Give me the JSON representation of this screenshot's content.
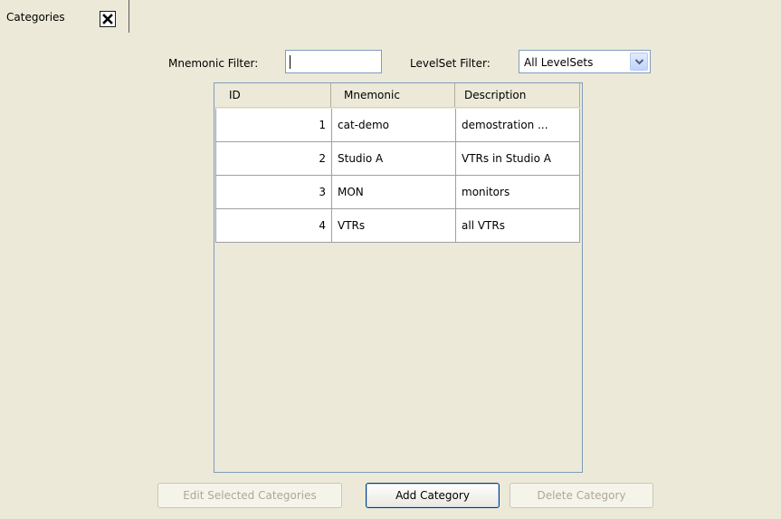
{
  "tab": {
    "label": "Categories",
    "close_icon": "close-icon"
  },
  "filters": {
    "mnemonic_label": "Mnemonic Filter:",
    "mnemonic_value": "",
    "levelset_label": "LevelSet Filter:",
    "levelset_selected": "All LevelSets"
  },
  "table": {
    "columns": [
      "ID",
      "Mnemonic",
      "Description"
    ],
    "rows": [
      {
        "id": "1",
        "mnemonic": "cat-demo",
        "description": "demostration ..."
      },
      {
        "id": "2",
        "mnemonic": "Studio A",
        "description": "VTRs in Studio A"
      },
      {
        "id": "3",
        "mnemonic": "MON",
        "description": "monitors"
      },
      {
        "id": "4",
        "mnemonic": "VTRs",
        "description": "all VTRs"
      }
    ]
  },
  "buttons": {
    "edit_label": "Edit Selected Categories",
    "add_label": "Add Category",
    "delete_label": "Delete Category"
  },
  "colors": {
    "background": "#ece9d8",
    "input_border": "#7f9db9",
    "default_button_border": "#003c74",
    "disabled_text": "#aca899"
  }
}
